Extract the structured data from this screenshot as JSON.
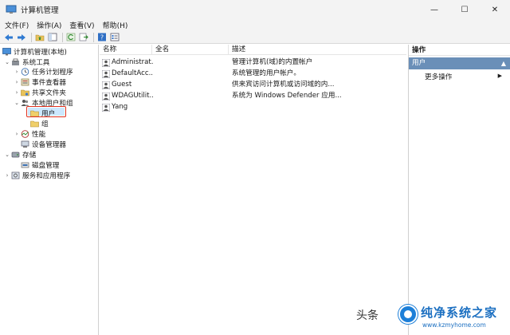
{
  "window": {
    "title": "计算机管理",
    "controls": {
      "minimize": "—",
      "maximize": "☐",
      "close": "✕"
    }
  },
  "menu": [
    "文件(F)",
    "操作(A)",
    "查看(V)",
    "帮助(H)"
  ],
  "toolbar": [
    "back-arrow-icon",
    "forward-arrow-icon",
    "folder-up-icon",
    "show-hide-tree-icon",
    "refresh-icon",
    "export-list-icon",
    "help-icon",
    "properties-icon"
  ],
  "tree": {
    "root": "计算机管理(本地)",
    "system_tools": "系统工具",
    "task_scheduler": "任务计划程序",
    "event_viewer": "事件查看器",
    "shared_folders": "共享文件夹",
    "local_users_groups": "本地用户和组",
    "users": "用户",
    "groups": "组",
    "performance": "性能",
    "device_manager": "设备管理器",
    "storage": "存储",
    "disk_management": "磁盘管理",
    "services_apps": "服务和应用程序"
  },
  "list": {
    "columns": [
      "名称",
      "全名",
      "描述"
    ],
    "rows": [
      {
        "name": "Administrat...",
        "fullname": "",
        "description": "管理计算机(域)的内置帐户"
      },
      {
        "name": "DefaultAcc...",
        "fullname": "",
        "description": "系统管理的用户帐户。"
      },
      {
        "name": "Guest",
        "fullname": "",
        "description": "供来宾访问计算机或访问域的内..."
      },
      {
        "name": "WDAGUtilit...",
        "fullname": "",
        "description": "系统为 Windows Defender 应用..."
      },
      {
        "name": "Yang",
        "fullname": "",
        "description": ""
      }
    ]
  },
  "actions": {
    "header": "操作",
    "section": "用户",
    "section_arrow": "▲",
    "more": "更多操作",
    "more_arrow": "▶"
  },
  "watermark": {
    "source": "头条",
    "brand": "纯净系统之家",
    "url": "www.kzmyhome.com"
  },
  "colors": {
    "selection": "#cce8ff",
    "highlight_border": "#e0301e",
    "action_section": "#6a8fb8",
    "brand_blue": "#1b6fc1"
  }
}
